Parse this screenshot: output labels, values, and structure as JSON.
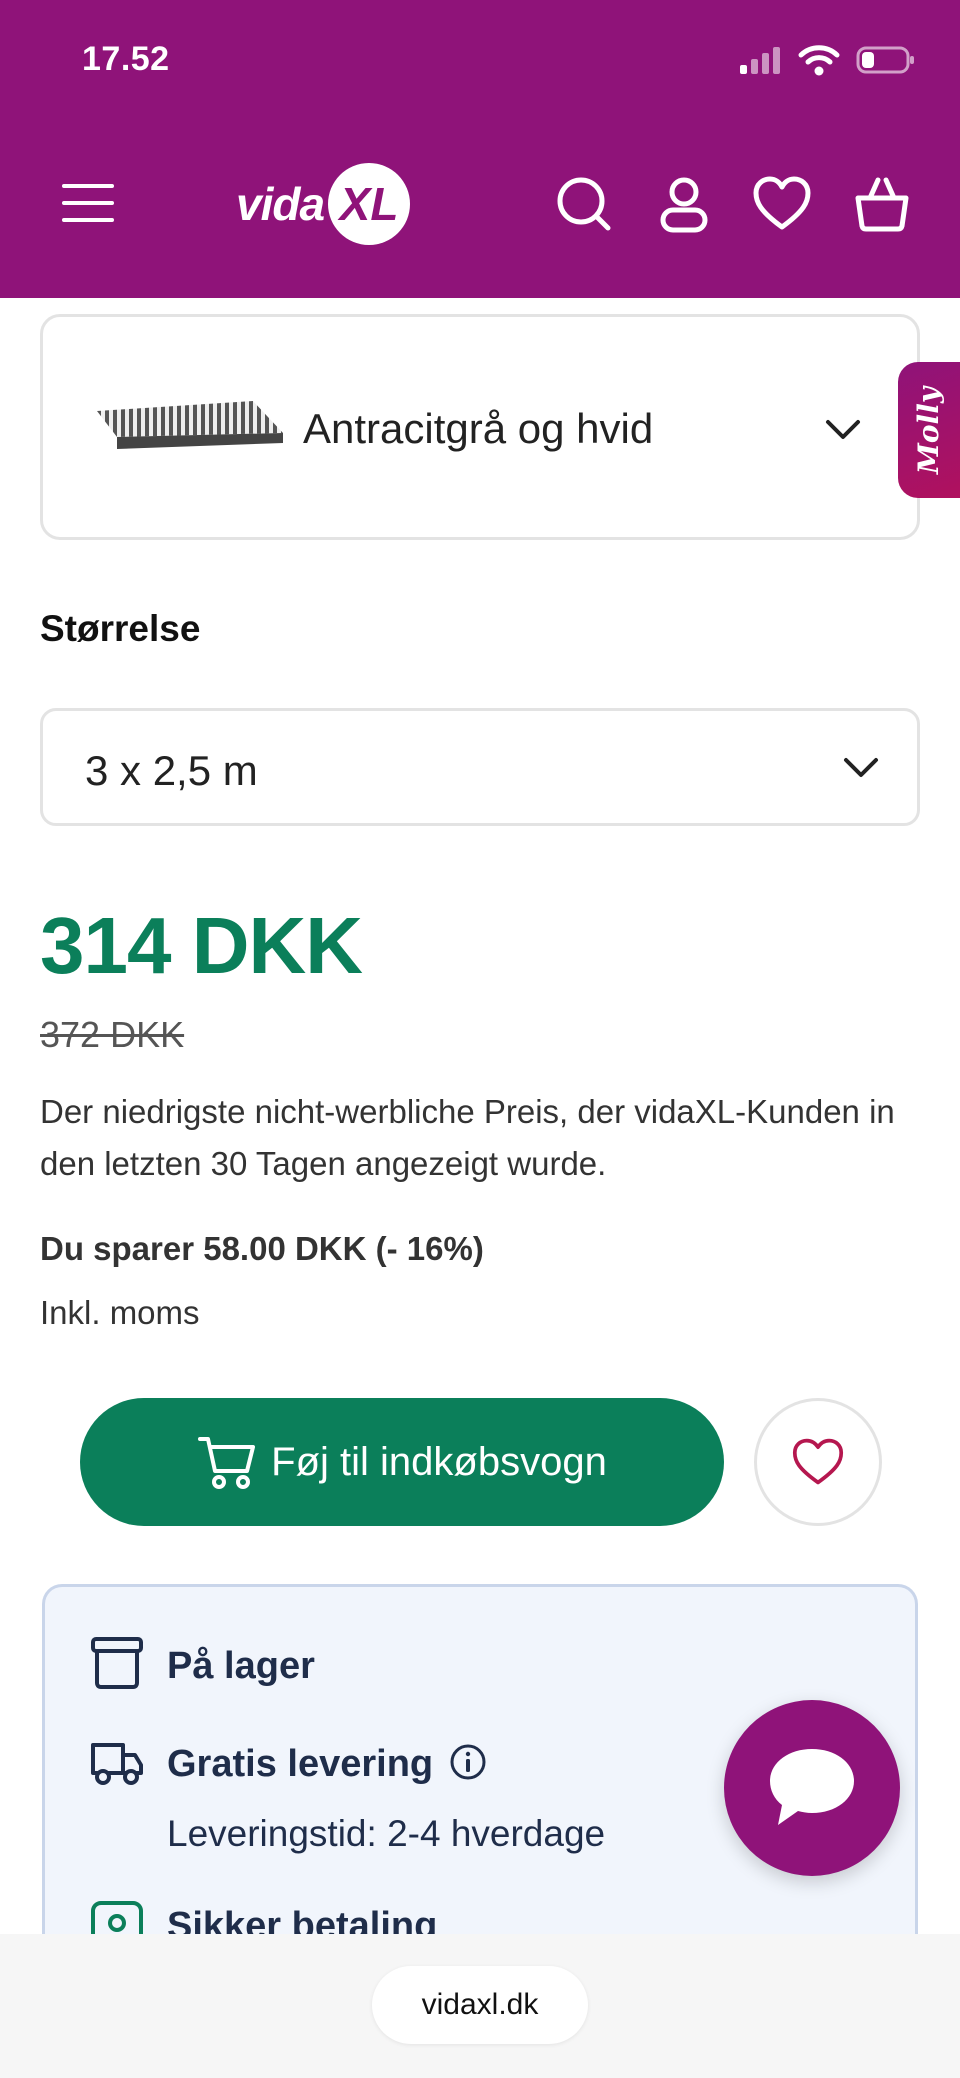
{
  "status_bar": {
    "time": "17.52"
  },
  "header": {
    "brand_text": "vida",
    "brand_mark": "XL",
    "icons": [
      "menu-icon",
      "search-icon",
      "user-icon",
      "heart-icon",
      "cart-icon"
    ]
  },
  "product": {
    "color_option": "Antracitgrå og hvid",
    "size_heading": "Størrelse",
    "size_option": "3 x 2,5 m",
    "price": "314 DKK",
    "old_price": "372 DKK",
    "price_note": "Der niedrigste nicht-werbliche Preis, der vidaXL-Kunden in den letzten 30 Tagen angezeigt wurde.",
    "savings": "Du sparer 58.00 DKK (- 16%)",
    "vat": "Inkl. moms",
    "add_to_cart": "Føj til indkøbsvogn"
  },
  "assistant_tab": {
    "label": "Molly"
  },
  "info": {
    "stock": "På lager",
    "shipping": "Gratis levering",
    "delivery_time": "Leveringstid: 2-4 hverdage",
    "payment": "Sikker betaling"
  },
  "browser": {
    "url": "vidaxl.dk"
  },
  "colors": {
    "brand_purple": "#8f1379",
    "price_green": "#0b7f5a",
    "info_bg": "#f1f5fc",
    "info_text": "#1f2d4a"
  }
}
